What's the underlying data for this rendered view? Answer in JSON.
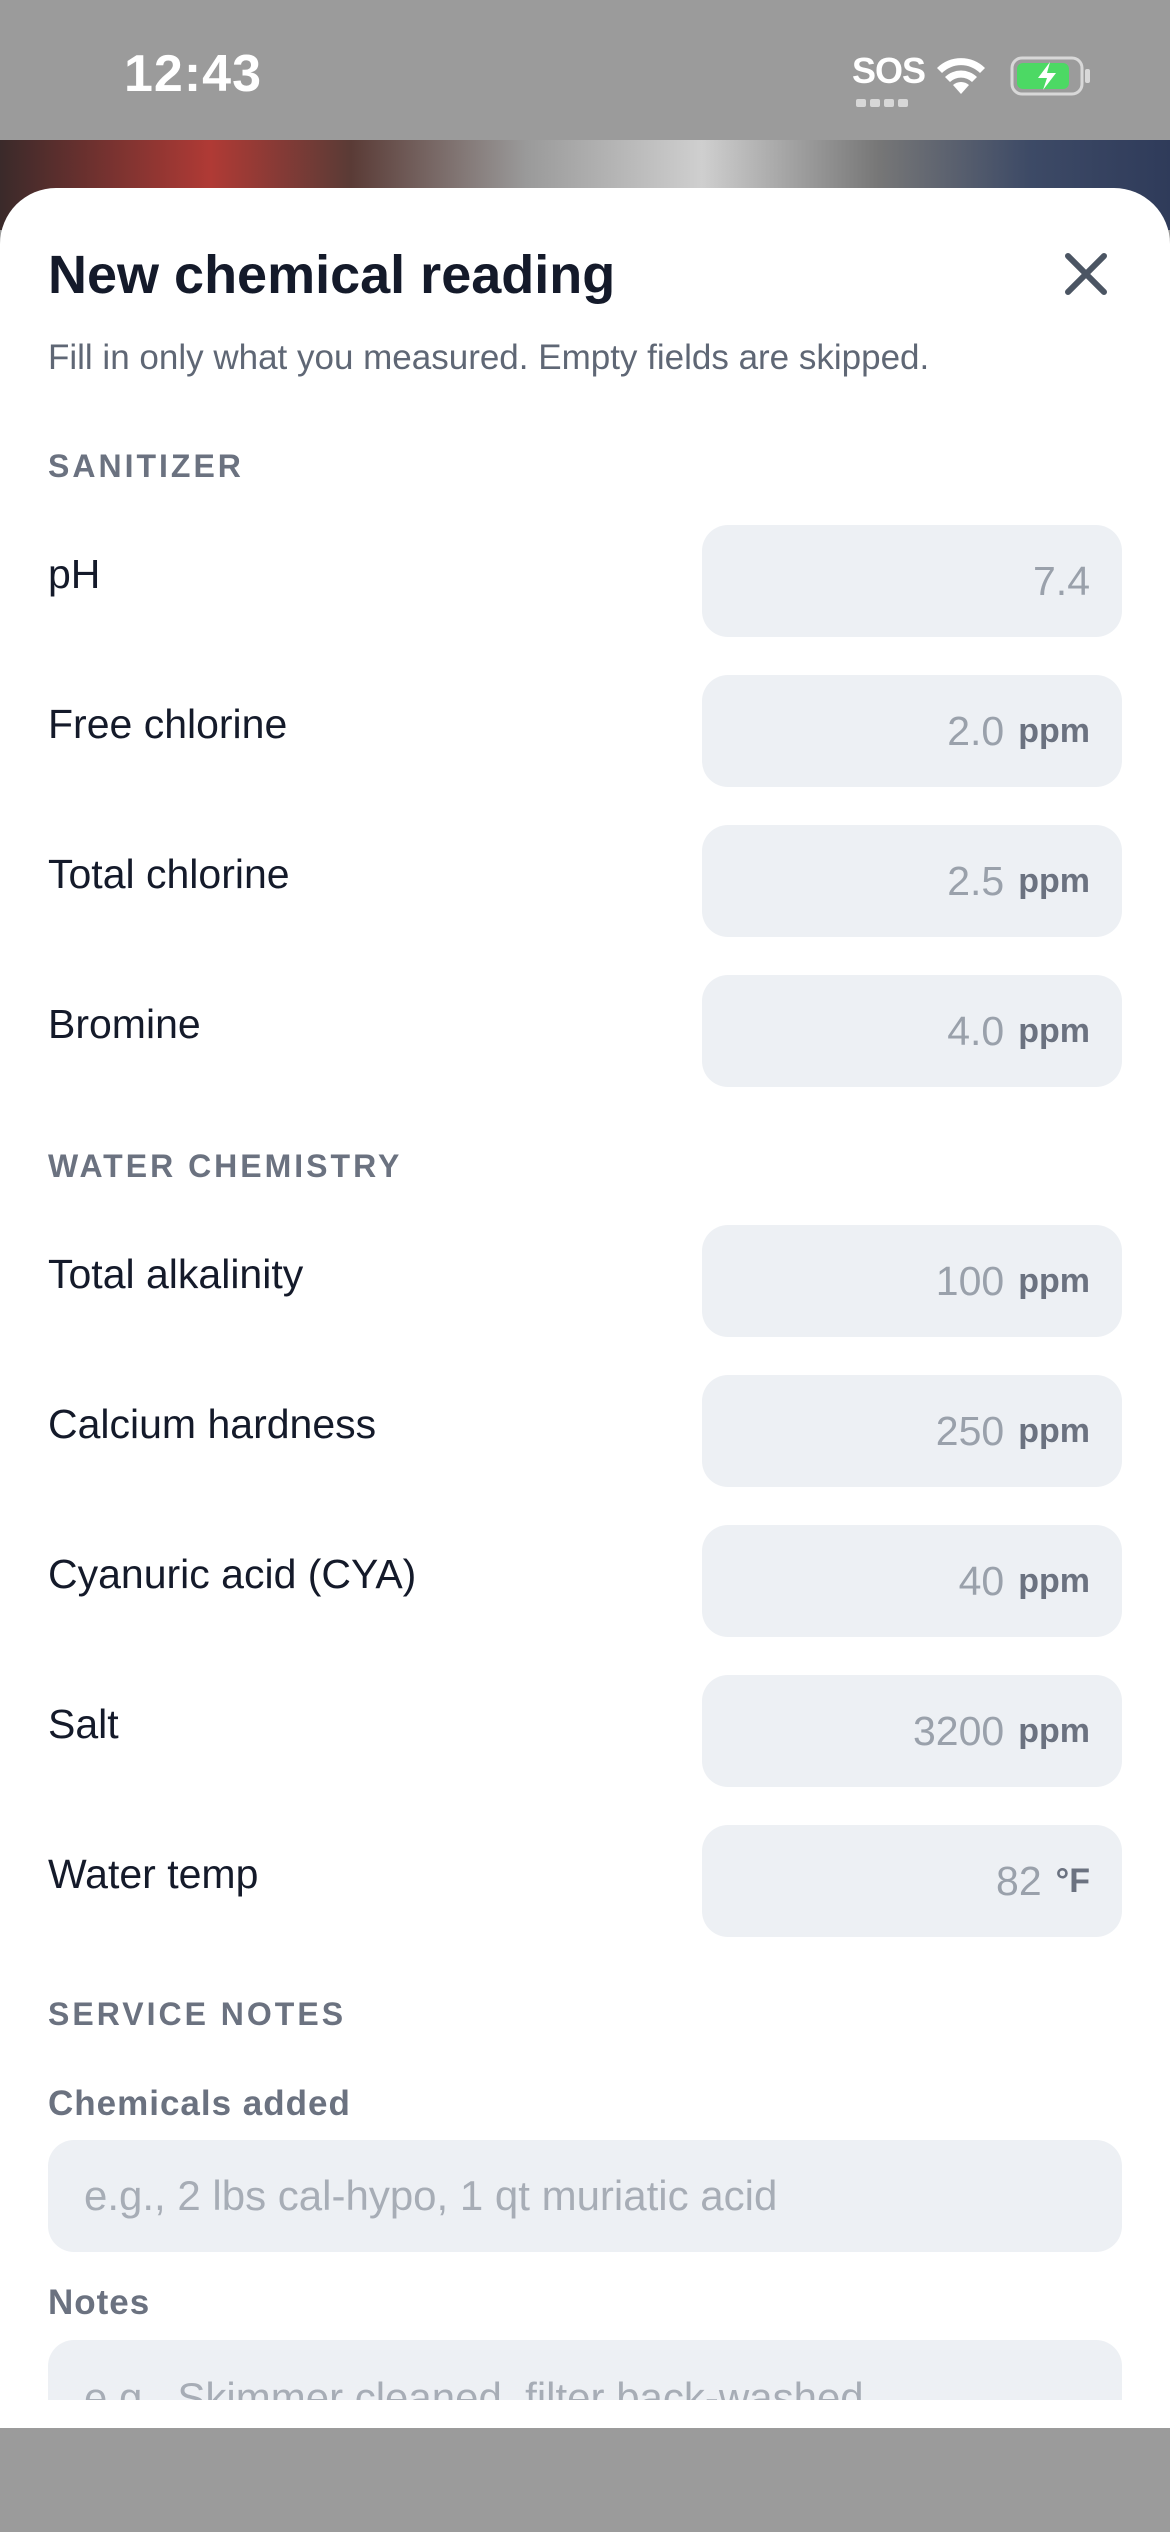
{
  "status_bar": {
    "time": "12:43",
    "sos": "SOS",
    "icons": [
      "wifi-icon",
      "battery-charging-icon"
    ]
  },
  "sheet": {
    "title": "New chemical reading",
    "close_icon": "close-icon",
    "subtitle": "Fill in only what you measured. Empty fields are skipped."
  },
  "sections": {
    "sanitizer": {
      "heading": "SANITIZER",
      "fields": [
        {
          "label": "pH",
          "placeholder": "7.4",
          "unit": ""
        },
        {
          "label": "Free chlorine",
          "placeholder": "2.0",
          "unit": "ppm"
        },
        {
          "label": "Total chlorine",
          "placeholder": "2.5",
          "unit": "ppm"
        },
        {
          "label": "Bromine",
          "placeholder": "4.0",
          "unit": "ppm"
        }
      ]
    },
    "water_chemistry": {
      "heading": "WATER CHEMISTRY",
      "fields": [
        {
          "label": "Total alkalinity",
          "placeholder": "100",
          "unit": "ppm"
        },
        {
          "label": "Calcium hardness",
          "placeholder": "250",
          "unit": "ppm"
        },
        {
          "label": "Cyanuric acid (CYA)",
          "placeholder": "40",
          "unit": "ppm"
        },
        {
          "label": "Salt",
          "placeholder": "3200",
          "unit": "ppm"
        },
        {
          "label": "Water temp",
          "placeholder": "82",
          "unit": "°F"
        }
      ]
    },
    "service_notes": {
      "heading": "SERVICE NOTES",
      "chemicals_label": "Chemicals added",
      "chemicals_placeholder": "e.g., 2 lbs cal-hypo, 1 qt muriatic acid",
      "notes_label": "Notes",
      "notes_placeholder": "e.g., Skimmer cleaned, filter back-washed"
    }
  },
  "colors": {
    "background_dim": "#9b9b9b",
    "sheet": "#ffffff",
    "field_bg": "#edf0f4",
    "title_text": "#141a2a",
    "muted_text": "#6b7280",
    "placeholder_text": "#9aa1ab",
    "battery_green": "#4cd964"
  }
}
